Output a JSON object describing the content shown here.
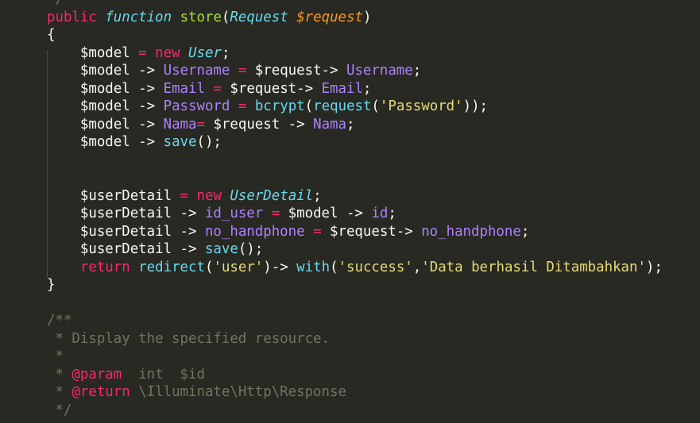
{
  "colors": {
    "background": "#282923",
    "plain": "#f8f8f2",
    "keyword": "#f92672",
    "storage": "#66d9ef",
    "function": "#a6e22e",
    "type": "#66d9ef",
    "parameter": "#fd971f",
    "property": "#ae81ff",
    "string": "#e6db74",
    "comment": "#75715e"
  },
  "editor": {
    "lines": [
      [
        {
          "t": "*/",
          "c": "comment"
        }
      ],
      [
        {
          "t": "public",
          "c": "keyword"
        },
        {
          "t": " ",
          "c": "plain"
        },
        {
          "t": "function",
          "c": "storage",
          "i": true
        },
        {
          "t": " ",
          "c": "plain"
        },
        {
          "t": "store",
          "c": "function"
        },
        {
          "t": "(",
          "c": "plain"
        },
        {
          "t": "Request",
          "c": "type",
          "i": true
        },
        {
          "t": " ",
          "c": "plain"
        },
        {
          "t": "$request",
          "c": "parameter",
          "i": true
        },
        {
          "t": ")",
          "c": "plain"
        }
      ],
      [
        {
          "t": "{",
          "c": "plain"
        }
      ],
      [
        {
          "t": "    $model ",
          "c": "plain"
        },
        {
          "t": "=",
          "c": "keyword"
        },
        {
          "t": " ",
          "c": "plain"
        },
        {
          "t": "new",
          "c": "keyword"
        },
        {
          "t": " ",
          "c": "plain"
        },
        {
          "t": "User",
          "c": "type",
          "i": true
        },
        {
          "t": ";",
          "c": "plain"
        }
      ],
      [
        {
          "t": "    $model -> ",
          "c": "plain"
        },
        {
          "t": "Username",
          "c": "property"
        },
        {
          "t": " ",
          "c": "plain"
        },
        {
          "t": "=",
          "c": "keyword"
        },
        {
          "t": " $request-> ",
          "c": "plain"
        },
        {
          "t": "Username",
          "c": "property"
        },
        {
          "t": ";",
          "c": "plain"
        }
      ],
      [
        {
          "t": "    $model -> ",
          "c": "plain"
        },
        {
          "t": "Email",
          "c": "property"
        },
        {
          "t": " ",
          "c": "plain"
        },
        {
          "t": "=",
          "c": "keyword"
        },
        {
          "t": " $request-> ",
          "c": "plain"
        },
        {
          "t": "Email",
          "c": "property"
        },
        {
          "t": ";",
          "c": "plain"
        }
      ],
      [
        {
          "t": "    $model -> ",
          "c": "plain"
        },
        {
          "t": "Password",
          "c": "property"
        },
        {
          "t": " ",
          "c": "plain"
        },
        {
          "t": "=",
          "c": "keyword"
        },
        {
          "t": " ",
          "c": "plain"
        },
        {
          "t": "bcrypt",
          "c": "storage"
        },
        {
          "t": "(",
          "c": "plain"
        },
        {
          "t": "request",
          "c": "storage"
        },
        {
          "t": "(",
          "c": "plain"
        },
        {
          "t": "'Password'",
          "c": "string"
        },
        {
          "t": "));",
          "c": "plain"
        }
      ],
      [
        {
          "t": "    $model -> ",
          "c": "plain"
        },
        {
          "t": "Nama",
          "c": "property"
        },
        {
          "t": "=",
          "c": "keyword"
        },
        {
          "t": " $request -> ",
          "c": "plain"
        },
        {
          "t": "Nama",
          "c": "property"
        },
        {
          "t": ";",
          "c": "plain"
        }
      ],
      [
        {
          "t": "    $model -> ",
          "c": "plain"
        },
        {
          "t": "save",
          "c": "storage"
        },
        {
          "t": "();",
          "c": "plain"
        }
      ],
      [],
      [],
      [
        {
          "t": "    $userDetail ",
          "c": "plain"
        },
        {
          "t": "=",
          "c": "keyword"
        },
        {
          "t": " ",
          "c": "plain"
        },
        {
          "t": "new",
          "c": "keyword"
        },
        {
          "t": " ",
          "c": "plain"
        },
        {
          "t": "UserDetail",
          "c": "type",
          "i": true
        },
        {
          "t": ";",
          "c": "plain"
        }
      ],
      [
        {
          "t": "    $userDetail -> ",
          "c": "plain"
        },
        {
          "t": "id_user",
          "c": "property"
        },
        {
          "t": " ",
          "c": "plain"
        },
        {
          "t": "=",
          "c": "keyword"
        },
        {
          "t": " $model -> ",
          "c": "plain"
        },
        {
          "t": "id",
          "c": "property"
        },
        {
          "t": ";",
          "c": "plain"
        }
      ],
      [
        {
          "t": "    $userDetail -> ",
          "c": "plain"
        },
        {
          "t": "no_handphone",
          "c": "property"
        },
        {
          "t": " ",
          "c": "plain"
        },
        {
          "t": "=",
          "c": "keyword"
        },
        {
          "t": " $request-> ",
          "c": "plain"
        },
        {
          "t": "no_handphone",
          "c": "property"
        },
        {
          "t": ";",
          "c": "plain"
        }
      ],
      [
        {
          "t": "    $userDetail -> ",
          "c": "plain"
        },
        {
          "t": "save",
          "c": "storage"
        },
        {
          "t": "();",
          "c": "plain"
        }
      ],
      [
        {
          "t": "    ",
          "c": "plain"
        },
        {
          "t": "return",
          "c": "keyword"
        },
        {
          "t": " ",
          "c": "plain"
        },
        {
          "t": "redirect",
          "c": "storage"
        },
        {
          "t": "(",
          "c": "plain"
        },
        {
          "t": "'user'",
          "c": "string"
        },
        {
          "t": ")-> ",
          "c": "plain"
        },
        {
          "t": "with",
          "c": "storage"
        },
        {
          "t": "(",
          "c": "plain"
        },
        {
          "t": "'success'",
          "c": "string"
        },
        {
          "t": ",",
          "c": "plain"
        },
        {
          "t": "'Data berhasil Ditambahkan'",
          "c": "string"
        },
        {
          "t": ");",
          "c": "plain"
        }
      ],
      [
        {
          "t": "}",
          "c": "plain"
        }
      ],
      [],
      [
        {
          "t": "/**",
          "c": "comment"
        }
      ],
      [
        {
          "t": " * Display the specified resource.",
          "c": "comment"
        }
      ],
      [
        {
          "t": " *",
          "c": "comment"
        }
      ],
      [
        {
          "t": " * ",
          "c": "comment"
        },
        {
          "t": "@param",
          "c": "keyword"
        },
        {
          "t": "  int  $id",
          "c": "comment"
        }
      ],
      [
        {
          "t": " * ",
          "c": "comment"
        },
        {
          "t": "@return",
          "c": "keyword"
        },
        {
          "t": " \\Illuminate\\Http\\Response",
          "c": "comment"
        }
      ],
      [
        {
          "t": " */",
          "c": "comment"
        }
      ]
    ]
  }
}
